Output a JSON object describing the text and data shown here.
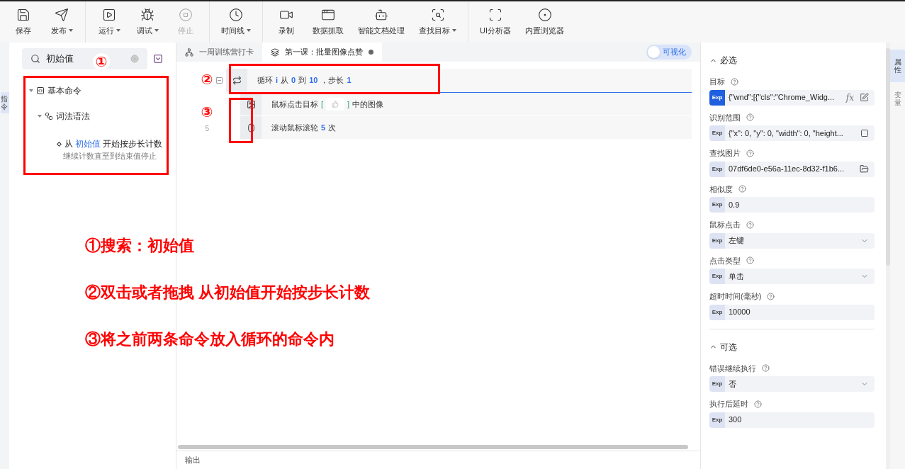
{
  "toolbar": [
    [
      {
        "label": "保存",
        "dropdown": false,
        "disabled": false
      },
      {
        "label": "发布",
        "dropdown": true,
        "disabled": false
      }
    ],
    [
      {
        "label": "运行",
        "dropdown": true,
        "disabled": false
      },
      {
        "label": "调试",
        "dropdown": true,
        "disabled": false
      },
      {
        "label": "停止",
        "dropdown": false,
        "disabled": true
      }
    ],
    [
      {
        "label": "时间线",
        "dropdown": true,
        "disabled": false
      }
    ],
    [
      {
        "label": "录制",
        "dropdown": false,
        "disabled": false
      },
      {
        "label": "数据抓取",
        "dropdown": false,
        "disabled": false
      },
      {
        "label": "智能文档处理",
        "dropdown": false,
        "disabled": false
      },
      {
        "label": "查找目标",
        "dropdown": true,
        "disabled": false
      }
    ],
    [
      {
        "label": "UI分析器",
        "dropdown": false,
        "disabled": false
      },
      {
        "label": "内置浏览器",
        "dropdown": false,
        "disabled": false
      }
    ]
  ],
  "left_tabs": [
    {
      "label": "指令",
      "selected": true
    }
  ],
  "search": {
    "value": "初始值"
  },
  "tree": [
    {
      "label": "基本命令",
      "expanded": true,
      "children": [
        {
          "label": "词法语法",
          "expanded": true,
          "children": [
            {
              "label_parts": [
                {
                  "text": "从",
                  "match": false
                },
                {
                  "text": "初始值",
                  "match": true
                },
                {
                  "text": "开始按步长计数",
                  "match": false
                }
              ],
              "description": "继续计数直至到结束值停止"
            }
          ]
        }
      ]
    }
  ],
  "editor_tabs": [
    {
      "label": "一周训练营打卡",
      "selected": false,
      "unsaved": false
    },
    {
      "label": "第一课：批量图像点赞",
      "selected": true,
      "unsaved": true
    }
  ],
  "visual_toggle": {
    "label": "可视化",
    "on": true
  },
  "steps": [
    {
      "collapsible": true,
      "parts": [
        {
          "text": "循环",
          "kind": "plain"
        },
        {
          "text": "i",
          "kind": "value"
        },
        {
          "text": "从",
          "kind": "plain"
        },
        {
          "text": "0",
          "kind": "value"
        },
        {
          "text": "到",
          "kind": "plain"
        },
        {
          "text": "10",
          "kind": "value"
        },
        {
          "text": "，步长",
          "kind": "plain"
        },
        {
          "text": "1",
          "kind": "value"
        }
      ]
    },
    {
      "collapsible": false,
      "parts": [
        {
          "text": "鼠标点击目标",
          "kind": "plain"
        },
        {
          "text": "[",
          "kind": "bracket"
        },
        {
          "kind": "thumb"
        },
        {
          "text": "]",
          "kind": "bracket"
        },
        {
          "text": "中的图像",
          "kind": "plain"
        }
      ]
    },
    {
      "line": "5",
      "collapsible": false,
      "parts": [
        {
          "text": "滚动鼠标滚轮",
          "kind": "plain"
        },
        {
          "text": "5",
          "kind": "value"
        },
        {
          "text": "次",
          "kind": "plain"
        }
      ]
    }
  ],
  "output_label": "输出",
  "properties": [
    {
      "title": "必选",
      "expanded": true,
      "fields": [
        {
          "label": "目标",
          "badge": "Exp",
          "value": "{\"wnd\":[{\"cls\":\"Chrome_Widg...",
          "kind": "target",
          "function_label": "fx",
          "exp_active": true
        },
        {
          "label": "识别范围",
          "badge": "Exp",
          "value": "{\"x\": 0, \"y\": 0, \"width\": 0, \"height...",
          "kind": "region",
          "exp_active": false
        },
        {
          "label": "查找图片",
          "badge": "Exp",
          "value": "07df6de0-e56a-11ec-8d32-f1b6...",
          "kind": "folder",
          "exp_active": false
        },
        {
          "label": "相似度",
          "badge": "Exp",
          "value": "0.9",
          "kind": "text",
          "exp_active": false
        },
        {
          "label": "鼠标点击",
          "badge": "Exp",
          "value": "左键",
          "kind": "select",
          "exp_active": false
        },
        {
          "label": "点击类型",
          "badge": "Exp",
          "value": "单击",
          "kind": "select",
          "exp_active": false
        },
        {
          "label": "超时时间(毫秒)",
          "badge": "Exp",
          "value": "10000",
          "kind": "text",
          "exp_active": false
        }
      ]
    },
    {
      "title": "可选",
      "expanded": true,
      "fields": [
        {
          "label": "错误继续执行",
          "badge": "Exp",
          "value": "否",
          "kind": "select",
          "exp_active": false
        },
        {
          "label": "执行后延时",
          "badge": "Exp",
          "value": "300",
          "kind": "text",
          "exp_active": false
        }
      ]
    }
  ],
  "right_tabs": [
    {
      "label": "属性",
      "selected": true
    },
    {
      "label": "变量",
      "selected": false
    }
  ],
  "markers": [
    "①",
    "②",
    "③"
  ],
  "notes": [
    "①搜索：初始值",
    "②双击或者拖拽 从初始值开始按步长计数",
    "③将之前两条命令放入循环的命令内"
  ]
}
